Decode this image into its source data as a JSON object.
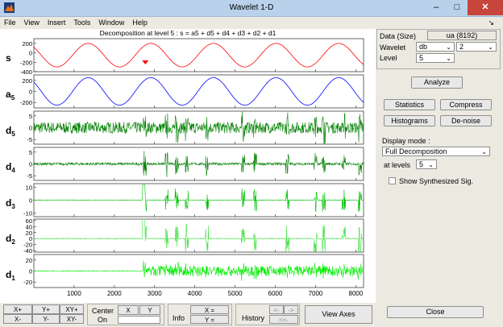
{
  "window": {
    "title": "Wavelet 1-D",
    "minimize_glyph": "–",
    "maximize_glyph": "□",
    "close_glyph": "✕",
    "dock_glyph": "↘"
  },
  "menu": [
    "File",
    "View",
    "Insert",
    "Tools",
    "Window",
    "Help"
  ],
  "plot_title": "Decomposition at level 5 : s = a5 + d5 + d4 + d3 + d2 + d1",
  "axes_labels": {
    "s": "s",
    "a": "a",
    "a_sub": "5",
    "d5": "d",
    "d5_sub": "5",
    "d4": "d",
    "d4_sub": "4",
    "d3": "d",
    "d3_sub": "3",
    "d2": "d",
    "d2_sub": "2",
    "d1": "d",
    "d1_sub": "1"
  },
  "chart_data": [
    {
      "type": "line",
      "name": "s",
      "color": "#ff0000",
      "yticks": [
        "200",
        "0",
        "-200",
        "-400"
      ],
      "ylim": [
        -400,
        300
      ]
    },
    {
      "type": "line",
      "name": "a5",
      "color": "#0000ff",
      "yticks": [
        "200",
        "0",
        "-200"
      ],
      "ylim": [
        -300,
        300
      ]
    },
    {
      "type": "line",
      "name": "d5",
      "color": "#008000",
      "yticks": [
        "5",
        "0",
        "-5"
      ],
      "ylim": [
        -7,
        7
      ]
    },
    {
      "type": "line",
      "name": "d4",
      "color": "#008000",
      "yticks": [
        "5",
        "0",
        "-5"
      ],
      "ylim": [
        -7,
        7
      ]
    },
    {
      "type": "line",
      "name": "d3",
      "color": "#00c000",
      "yticks": [
        "10",
        "0",
        "-10"
      ],
      "ylim": [
        -13,
        13
      ]
    },
    {
      "type": "line",
      "name": "d2",
      "color": "#40e040",
      "yticks": [
        "60",
        "40",
        "20",
        "0",
        "-20",
        "-40"
      ],
      "ylim": [
        -45,
        65
      ]
    },
    {
      "type": "line",
      "name": "d1",
      "color": "#00ee00",
      "yticks": [
        "20",
        "0",
        "-20"
      ],
      "ylim": [
        -30,
        30
      ]
    }
  ],
  "xaxis": {
    "ticks": [
      "1000",
      "2000",
      "3000",
      "4000",
      "5000",
      "6000",
      "7000",
      "8000"
    ],
    "xlim": [
      0,
      8192
    ]
  },
  "panel": {
    "data_label": "Data  (Size)",
    "data_value": "ua  (8192)",
    "wavelet_label": "Wavelet",
    "wavelet_family": "db",
    "wavelet_order": "2",
    "level_label": "Level",
    "level_value": "5",
    "analyze": "Analyze",
    "statistics": "Statistics",
    "compress": "Compress",
    "histograms": "Histograms",
    "denoise": "De-noise",
    "display_mode_label": "Display mode :",
    "display_mode_value": "Full Decomposition",
    "at_levels_label": "at levels",
    "at_levels_value": "5",
    "show_synth": "Show Synthesized Sig.",
    "close": "Close"
  },
  "bottom": {
    "xplus": "X+",
    "yplus": "Y+",
    "xyplus": "XY+",
    "xminus": "X-",
    "yminus": "Y-",
    "xyminus": "XY-",
    "center": "Center",
    "on": "On",
    "x": "X",
    "y": "Y",
    "info": "Info",
    "xeq": "X =",
    "yeq": "Y =",
    "history": "History",
    "hist_left": "<-",
    "hist_right": "->",
    "hist_back": "<<-",
    "view_axes": "View Axes"
  }
}
